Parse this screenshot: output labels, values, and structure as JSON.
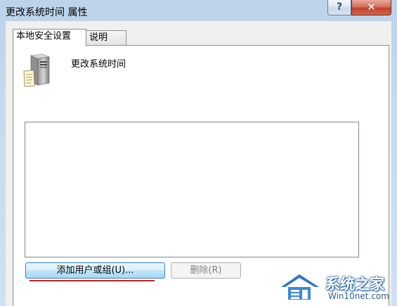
{
  "window": {
    "title": "更改系统时间 属性",
    "help_label": "?",
    "close_label": "✕"
  },
  "tabs": [
    {
      "label": "本地安全设置",
      "active": true
    },
    {
      "label": "说明",
      "active": false
    }
  ],
  "policy": {
    "name": "更改系统时间",
    "icon": "server-policy-icon"
  },
  "members_list": {
    "items": []
  },
  "buttons": {
    "add_label": "添加用户或组(U)...",
    "remove_label": "删除(R)"
  },
  "colors": {
    "title_bar": "#c6dbef",
    "close_button": "#c0432d",
    "annotation_underline": "#c8211c"
  },
  "watermark": {
    "brand": "系统之家",
    "site": "Win10net.com"
  }
}
